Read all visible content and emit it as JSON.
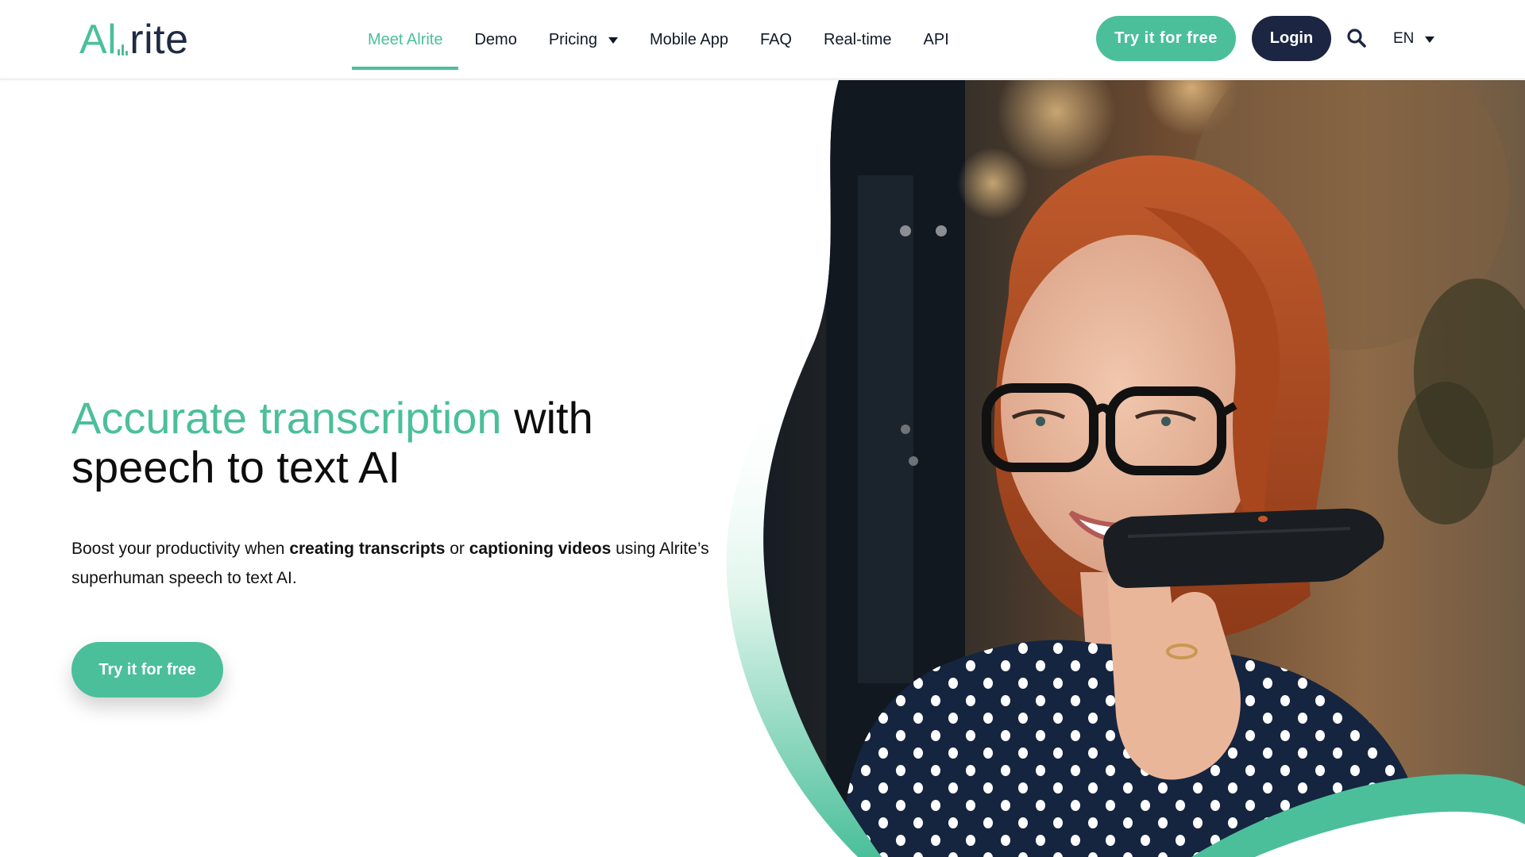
{
  "header": {
    "logo_text": "rite",
    "logo_prefix": "Al",
    "nav": [
      {
        "label": "Meet Alrite",
        "active": true
      },
      {
        "label": "Demo"
      },
      {
        "label": "Pricing",
        "has_dropdown": true
      },
      {
        "label": "Mobile App"
      },
      {
        "label": "FAQ"
      },
      {
        "label": "Real-time"
      },
      {
        "label": "API"
      }
    ],
    "try_button": "Try it for free",
    "login_button": "Login",
    "search_icon": "search-icon",
    "language": "EN"
  },
  "hero": {
    "headline_accent": "Accurate transcription",
    "headline_rest": " with speech to text AI",
    "sub_1": "Boost your productivity when ",
    "sub_bold_1": "creating transcripts",
    "sub_2": " or ",
    "sub_bold_2": "captioning videos",
    "sub_3": " using Alrite’s superhuman speech to text AI.",
    "cta": "Try it for free",
    "image": "woman-speaking-into-phone-photo"
  },
  "colors": {
    "accent": "#4bbf9a",
    "navy": "#1c2643",
    "text": "#111111"
  }
}
